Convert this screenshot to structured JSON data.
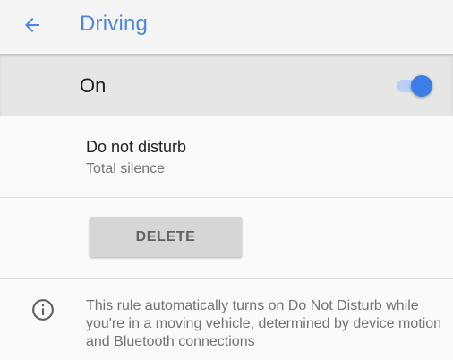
{
  "header": {
    "title": "Driving",
    "back_icon": "arrow-back-icon",
    "accent_color": "#4a86e8"
  },
  "master_switch": {
    "label": "On",
    "state": "on",
    "thumb_color": "#3d7ee6",
    "track_color": "#b9cff6"
  },
  "dnd_preference": {
    "title": "Do not disturb",
    "summary": "Total silence"
  },
  "delete_button": {
    "label": "DELETE"
  },
  "footer_info": {
    "icon": "info-icon",
    "text": "This rule automatically turns on Do Not Disturb while you're in a moving vehicle, determined by device motion and Bluetooth connections"
  }
}
